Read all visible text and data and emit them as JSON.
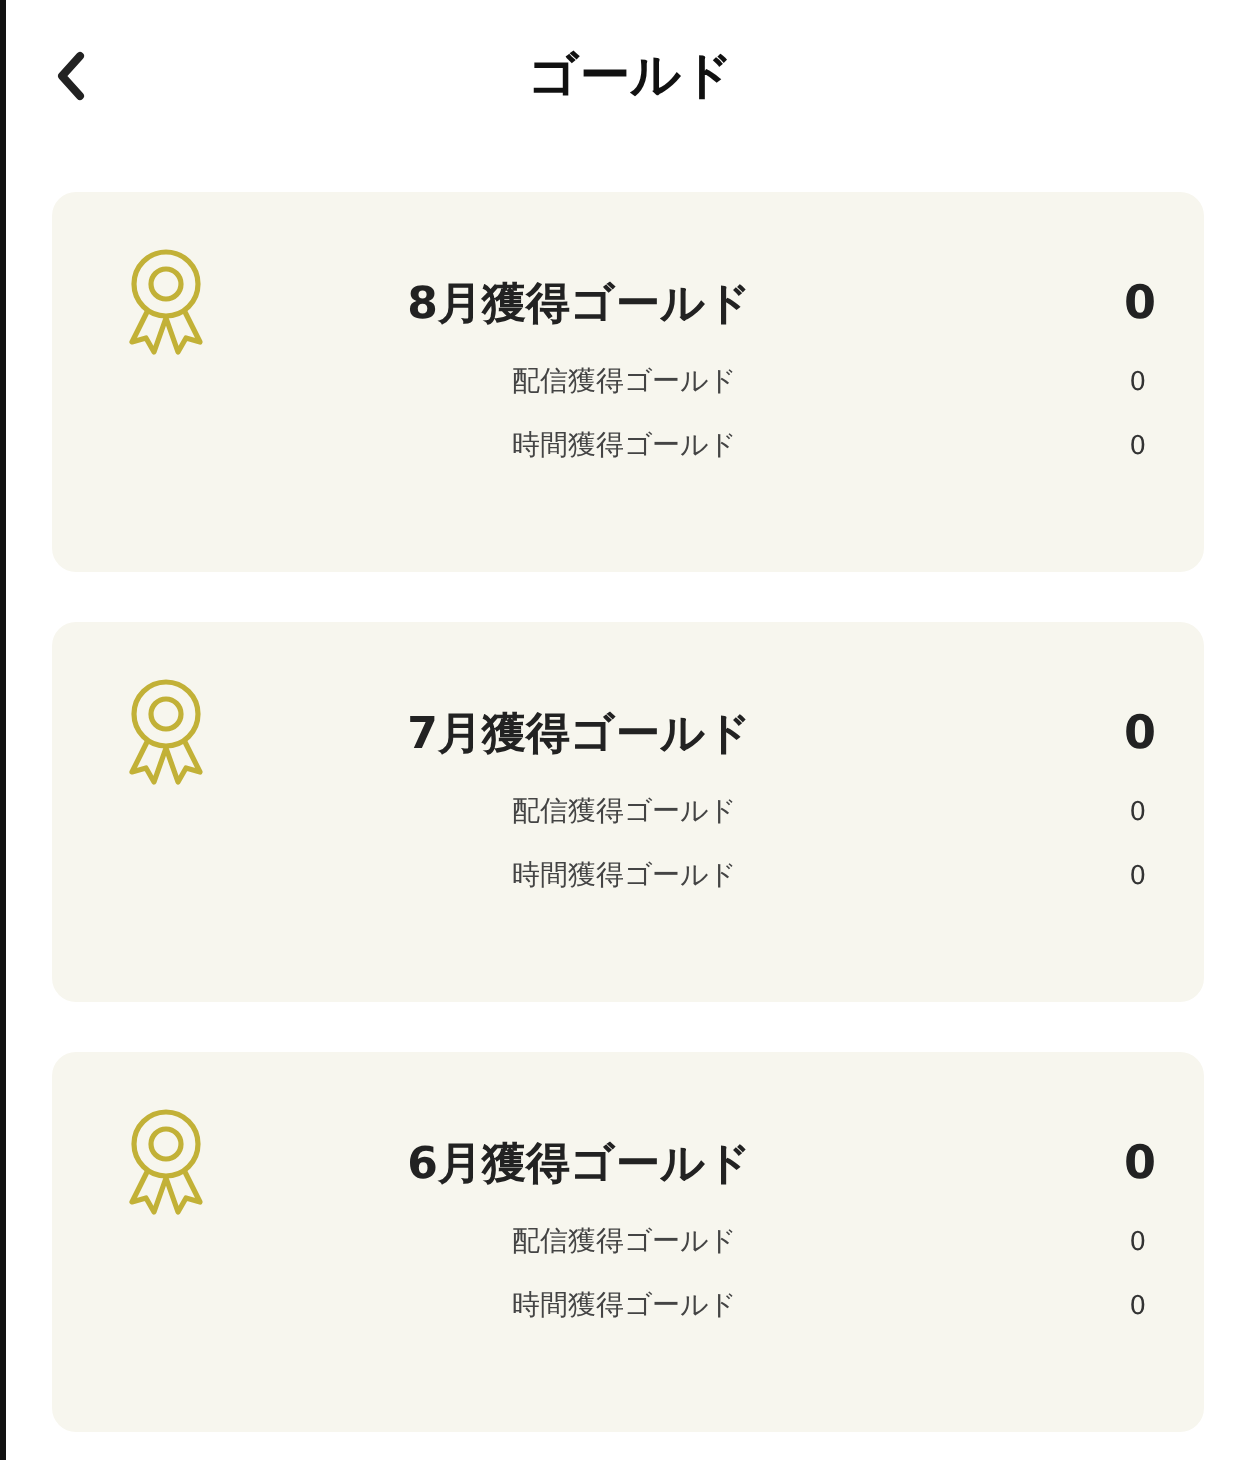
{
  "header": {
    "title": "ゴールド"
  },
  "cards": [
    {
      "title": "8月獲得ゴールド",
      "total": "0",
      "rows": [
        {
          "label": "配信獲得ゴールド",
          "value": "0"
        },
        {
          "label": "時間獲得ゴールド",
          "value": "0"
        }
      ]
    },
    {
      "title": "7月獲得ゴールド",
      "total": "0",
      "rows": [
        {
          "label": "配信獲得ゴールド",
          "value": "0"
        },
        {
          "label": "時間獲得ゴールド",
          "value": "0"
        }
      ]
    },
    {
      "title": "6月獲得ゴールド",
      "total": "0",
      "rows": [
        {
          "label": "配信獲得ゴールド",
          "value": "0"
        },
        {
          "label": "時間獲得ゴールド",
          "value": "0"
        }
      ]
    }
  ]
}
